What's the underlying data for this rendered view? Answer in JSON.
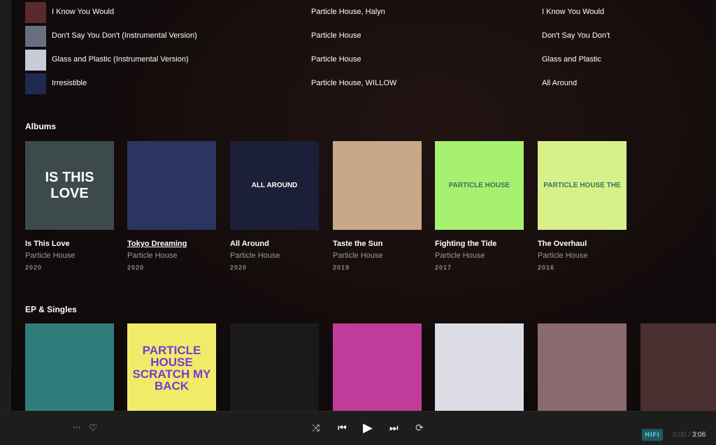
{
  "tracks": [
    {
      "title": "I Know You Would",
      "artist": "Particle House, Halyn",
      "album": "I Know You Would",
      "color": "#5a2a2a"
    },
    {
      "title": "Don't Say You Don't (Instrumental Version)",
      "artist": "Particle House",
      "album": "Don't Say You Don't",
      "color": "#6a6e80"
    },
    {
      "title": "Glass and Plastic (Instrumental Version)",
      "artist": "Particle House",
      "album": "Glass and Plastic",
      "color": "#c8ccd8"
    },
    {
      "title": "Irresistible",
      "artist": "Particle House, WILLOW",
      "album": "All Around",
      "color": "#1e2a50"
    }
  ],
  "albums_heading": "Albums",
  "albums": [
    {
      "title": "Is This Love",
      "artist": "Particle House",
      "year": "2020",
      "cover_text": "IS THIS LOVE",
      "bg": "#3c4a4c"
    },
    {
      "title": "Tokyo Dreaming",
      "artist": "Particle House",
      "year": "2020",
      "cover_text": "",
      "bg": "#2a3560"
    },
    {
      "title": "All Around",
      "artist": "Particle House",
      "year": "2020",
      "cover_text": "ALL AROUND",
      "bg": "#1b2038"
    },
    {
      "title": "Taste the Sun",
      "artist": "Particle House",
      "year": "2019",
      "cover_text": "",
      "bg": "#c8a888"
    },
    {
      "title": "Fighting the Tide",
      "artist": "Particle House",
      "year": "2017",
      "cover_text": "PARTICLE HOUSE",
      "bg": "#a8f070"
    },
    {
      "title": "The Overhaul",
      "artist": "Particle House",
      "year": "2016",
      "cover_text": "PARTICLE HOUSE THE",
      "bg": "#d8f08a"
    }
  ],
  "eps_heading": "EP & Singles",
  "eps": [
    {
      "cover_text": "",
      "bg": "#2f7d7a"
    },
    {
      "cover_text": "PARTICLE HOUSE SCRATCH MY BACK",
      "bg": "#f0ec6a"
    },
    {
      "cover_text": "",
      "bg": "#1a1a1a"
    },
    {
      "cover_text": "",
      "bg": "#c03c9a"
    },
    {
      "cover_text": "",
      "bg": "#dcdce4"
    },
    {
      "cover_text": "",
      "bg": "#8a6a6e"
    },
    {
      "cover_text": "",
      "bg": "#4a3030"
    }
  ],
  "player": {
    "more": "···",
    "heart": "♡",
    "shuffle": "⤨",
    "prev": "⏮",
    "play": "▶",
    "next": "⏭",
    "repeat": "⟳",
    "quality": "HIFI",
    "elapsed": "0:00",
    "separator": "/",
    "duration": "3:06"
  }
}
